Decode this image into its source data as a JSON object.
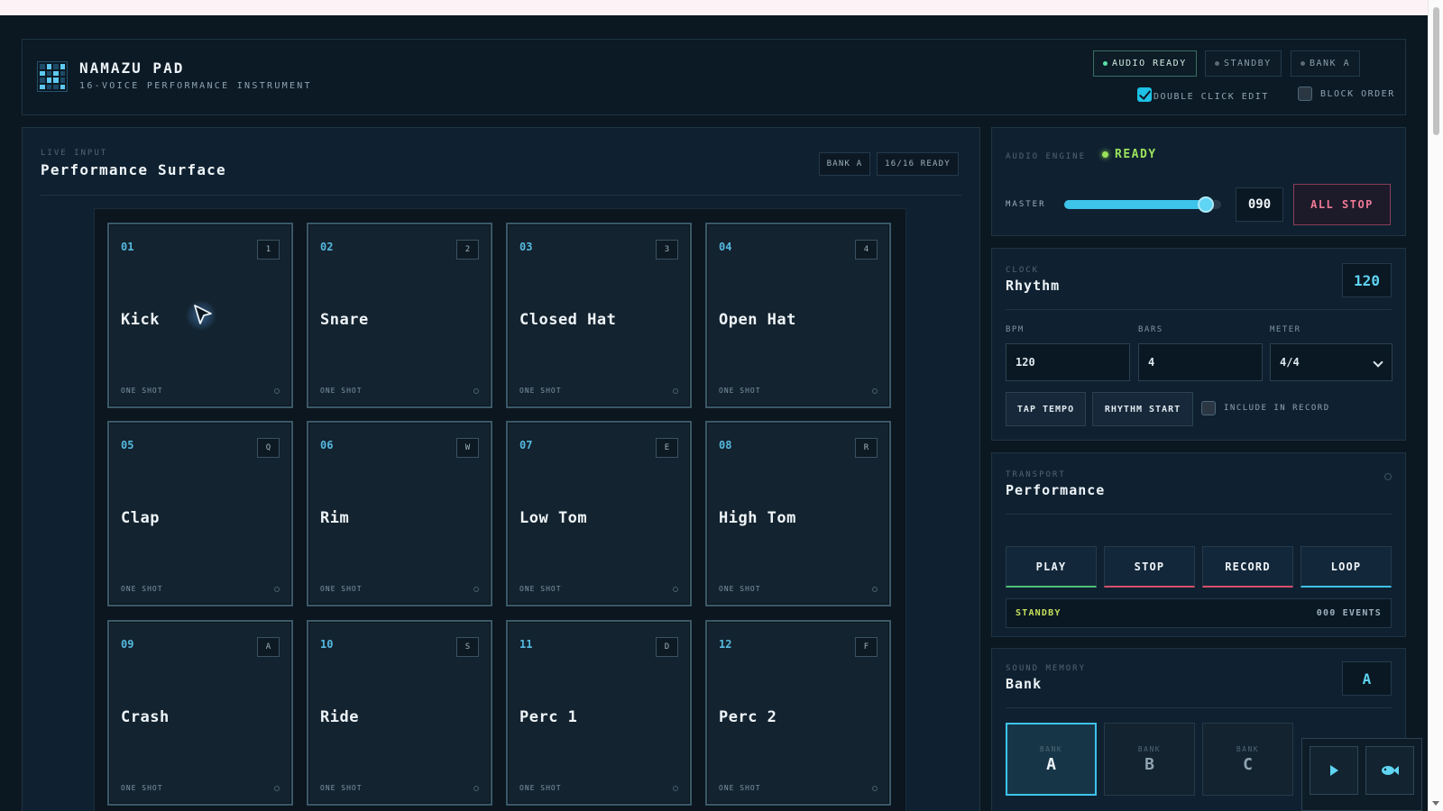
{
  "app": {
    "title": "NAMAZU PAD",
    "subtitle": "16-VOICE PERFORMANCE INSTRUMENT",
    "badges": [
      {
        "label": "AUDIO READY",
        "active": true
      },
      {
        "label": "STANDBY",
        "active": false
      },
      {
        "label": "BANK A",
        "active": false
      }
    ],
    "options": [
      {
        "label": "DOUBLE CLICK EDIT",
        "checked": true
      },
      {
        "label": "BLOCK ORDER",
        "checked": false
      }
    ]
  },
  "surface": {
    "eyebrow": "LIVE INPUT",
    "title": "Performance Surface",
    "bank_chip": "BANK A",
    "ready_chip": "16/16 READY",
    "pads": [
      {
        "num": "01",
        "key": "1",
        "name": "Kick",
        "mode": "ONE SHOT"
      },
      {
        "num": "02",
        "key": "2",
        "name": "Snare",
        "mode": "ONE SHOT"
      },
      {
        "num": "03",
        "key": "3",
        "name": "Closed Hat",
        "mode": "ONE SHOT"
      },
      {
        "num": "04",
        "key": "4",
        "name": "Open Hat",
        "mode": "ONE SHOT"
      },
      {
        "num": "05",
        "key": "Q",
        "name": "Clap",
        "mode": "ONE SHOT"
      },
      {
        "num": "06",
        "key": "W",
        "name": "Rim",
        "mode": "ONE SHOT"
      },
      {
        "num": "07",
        "key": "E",
        "name": "Low Tom",
        "mode": "ONE SHOT"
      },
      {
        "num": "08",
        "key": "R",
        "name": "High Tom",
        "mode": "ONE SHOT"
      },
      {
        "num": "09",
        "key": "A",
        "name": "Crash",
        "mode": "ONE SHOT"
      },
      {
        "num": "10",
        "key": "S",
        "name": "Ride",
        "mode": "ONE SHOT"
      },
      {
        "num": "11",
        "key": "D",
        "name": "Perc 1",
        "mode": "ONE SHOT"
      },
      {
        "num": "12",
        "key": "F",
        "name": "Perc 2",
        "mode": "ONE SHOT"
      }
    ]
  },
  "engine": {
    "label": "AUDIO ENGINE",
    "status": "READY",
    "master_label": "MASTER",
    "master_level": 0.9,
    "master_value": "090",
    "all_stop": "ALL STOP"
  },
  "clock": {
    "eyebrow": "CLOCK",
    "title": "Rhythm",
    "bpm_display": "120",
    "bpm_label": "BPM",
    "bpm_value": "120",
    "bars_label": "BARS",
    "bars_value": "4",
    "meter_label": "METER",
    "meter_value": "4/4",
    "tap_tempo": "TAP TEMPO",
    "rhythm_start": "RHYTHM START",
    "include_label": "INCLUDE IN RECORD",
    "include_checked": false
  },
  "transport": {
    "eyebrow": "TRANSPORT",
    "title": "Performance",
    "buttons": [
      {
        "label": "PLAY",
        "accent": "#4ec07a"
      },
      {
        "label": "STOP",
        "accent": "#d6506c"
      },
      {
        "label": "RECORD",
        "accent": "#d6506c"
      },
      {
        "label": "LOOP",
        "accent": "#3ec3ea"
      }
    ],
    "status": "STANDBY",
    "events": "000 EVENTS"
  },
  "memory": {
    "eyebrow": "SOUND MEMORY",
    "title": "Bank",
    "current": "A",
    "banks": [
      {
        "label": "BANK",
        "value": "A",
        "active": true
      },
      {
        "label": "BANK",
        "value": "B",
        "active": false
      },
      {
        "label": "BANK",
        "value": "C",
        "active": false
      }
    ]
  },
  "floating": {
    "play_icon": "play-icon",
    "fish_icon": "fish-icon"
  },
  "colors": {
    "accent": "#3ec3ea",
    "ready": "#9ae25a",
    "alert": "#ef7a96",
    "status_standby": "#c6e05a"
  }
}
